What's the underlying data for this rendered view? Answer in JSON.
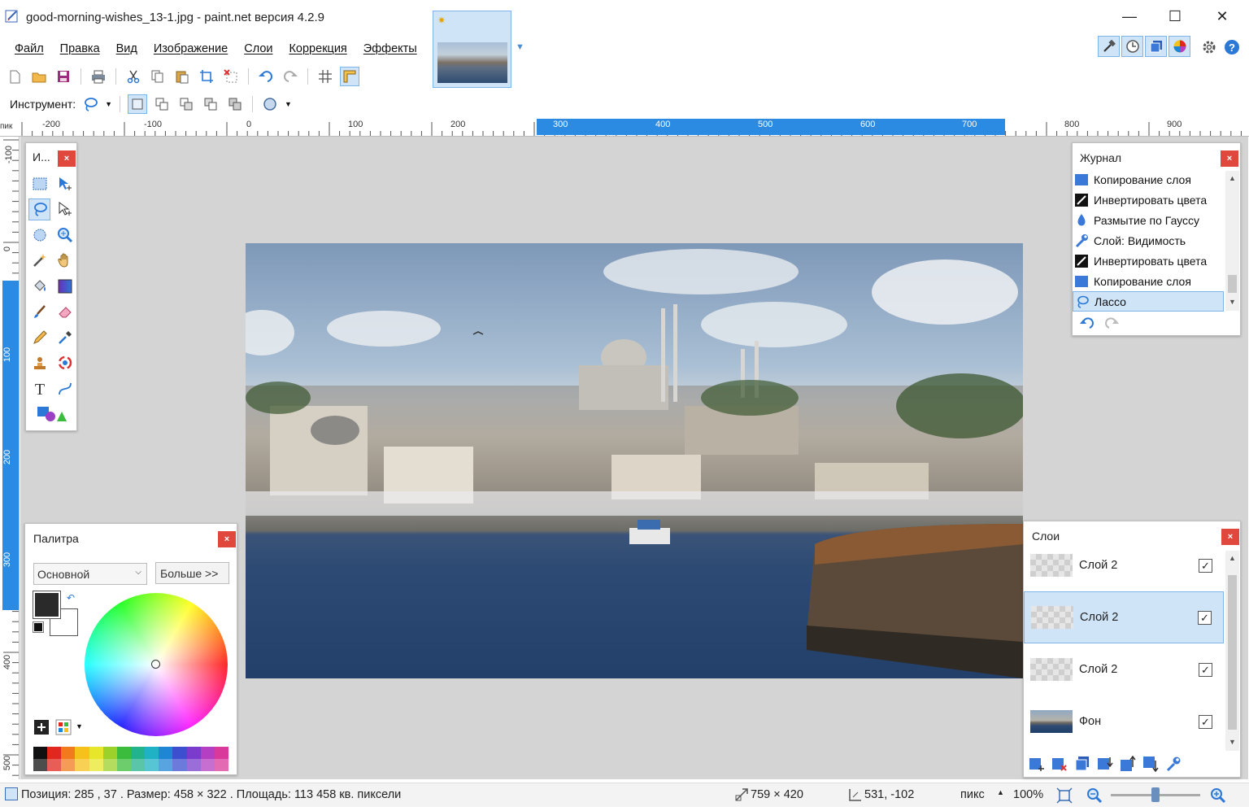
{
  "window": {
    "title": "good-morning-wishes_13-1.jpg - paint.net версия 4.2.9",
    "minimize": "—",
    "maximize": "☐",
    "close": "✕"
  },
  "menu": [
    "Файл",
    "Правка",
    "Вид",
    "Изображение",
    "Слои",
    "Коррекция",
    "Эффекты"
  ],
  "toolbar": {
    "instrument_label": "Инструмент:"
  },
  "rulers": {
    "unit": "пик",
    "h_labels": [
      "-200",
      "-100",
      "0",
      "100",
      "200",
      "300",
      "400",
      "500",
      "600",
      "700",
      "800",
      "900"
    ],
    "v_labels": [
      "-100",
      "0",
      "100",
      "200",
      "300",
      "400",
      "500"
    ]
  },
  "tools_panel": {
    "title": "И...",
    "close": "×"
  },
  "history_panel": {
    "title": "Журнал",
    "close": "×",
    "items": [
      {
        "label": "Копирование слоя",
        "icon": "copy-layer-icon"
      },
      {
        "label": "Инвертировать цвета",
        "icon": "invert-colors-icon"
      },
      {
        "label": "Размытие по Гауссу",
        "icon": "gaussian-blur-icon"
      },
      {
        "label": "Слой: Видимость",
        "icon": "wrench-icon"
      },
      {
        "label": "Инвертировать цвета",
        "icon": "invert-colors-icon"
      },
      {
        "label": "Копирование слоя",
        "icon": "copy-layer-icon"
      },
      {
        "label": "Лассо",
        "icon": "lasso-icon",
        "selected": true
      }
    ]
  },
  "palette_panel": {
    "title": "Палитра",
    "close": "×",
    "mode_value": "Основной",
    "more_button": "Больше >>",
    "swatches": [
      "#111111",
      "#e0281f",
      "#f07a1c",
      "#f5c21b",
      "#e8e62a",
      "#9bd12a",
      "#3cbc3c",
      "#23b38a",
      "#1fb2c5",
      "#1f86d6",
      "#3b4fcf",
      "#7a3ccc",
      "#b43fc2",
      "#d8399a"
    ]
  },
  "layers_panel": {
    "title": "Слои",
    "close": "×",
    "layers": [
      {
        "name": "Слой 2",
        "visible": true,
        "selected": false
      },
      {
        "name": "Слой 2",
        "visible": true,
        "selected": true
      },
      {
        "name": "Слой 2",
        "visible": true,
        "selected": false
      },
      {
        "name": "Фон",
        "visible": true,
        "selected": false
      }
    ]
  },
  "status": {
    "position_text": "Позиция: 285 , 37 . Размер: 458  × 322 . Площадь: 113 458 кв. пиксели",
    "image_size": "759 × 420",
    "cursor": "531, -102",
    "units": "пикс",
    "zoom": "100%"
  },
  "colors": {
    "accent": "#2b8ae2",
    "selection_bg": "#cfe4f7",
    "selection_border": "#7eb4ea",
    "close_red": "#e0483e",
    "canvas_bg": "#d4d4d4"
  }
}
